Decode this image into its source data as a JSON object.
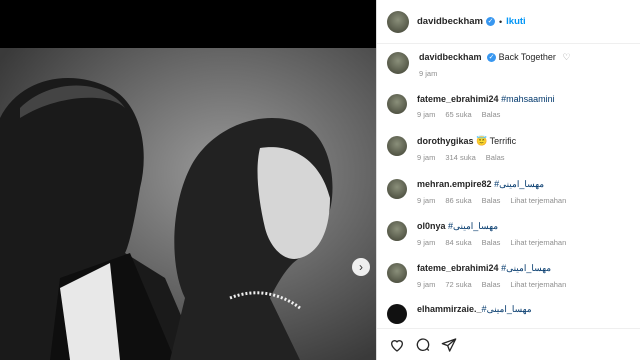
{
  "post": {
    "username": "davidbeckham",
    "follow_label": "Ikuti",
    "caption": "Back Together",
    "caption_time": "9 jam"
  },
  "comments": [
    {
      "username": "fateme_ebrahimi24",
      "text": "#mahsaamini",
      "time": "9 jam",
      "likes": "65 suka",
      "reply": "Balas",
      "translate": ""
    },
    {
      "username": "dorothygikas",
      "text": "😇 Terrific",
      "time": "9 jam",
      "likes": "314 suka",
      "reply": "Balas",
      "translate": ""
    },
    {
      "username": "mehran.empire82",
      "text": "#مهسا_امینی",
      "time": "9 jam",
      "likes": "86 suka",
      "reply": "Balas",
      "translate": "Lihat terjemahan"
    },
    {
      "username": "ol0nya",
      "text": "#مهسا_امینی",
      "time": "9 jam",
      "likes": "84 suka",
      "reply": "Balas",
      "translate": "Lihat terjemahan"
    },
    {
      "username": "fateme_ebrahimi24",
      "text": "#مهسا_امینی",
      "time": "9 jam",
      "likes": "72 suka",
      "reply": "Balas",
      "translate": "Lihat terjemahan"
    },
    {
      "username": "elhammirzaie._",
      "text": "#مهسا_امینی",
      "time": "",
      "likes": "",
      "reply": "",
      "translate": ""
    }
  ],
  "icons": [
    "heart-icon",
    "comment-icon",
    "share-icon",
    "chevron-right-icon",
    "verified-icon"
  ]
}
